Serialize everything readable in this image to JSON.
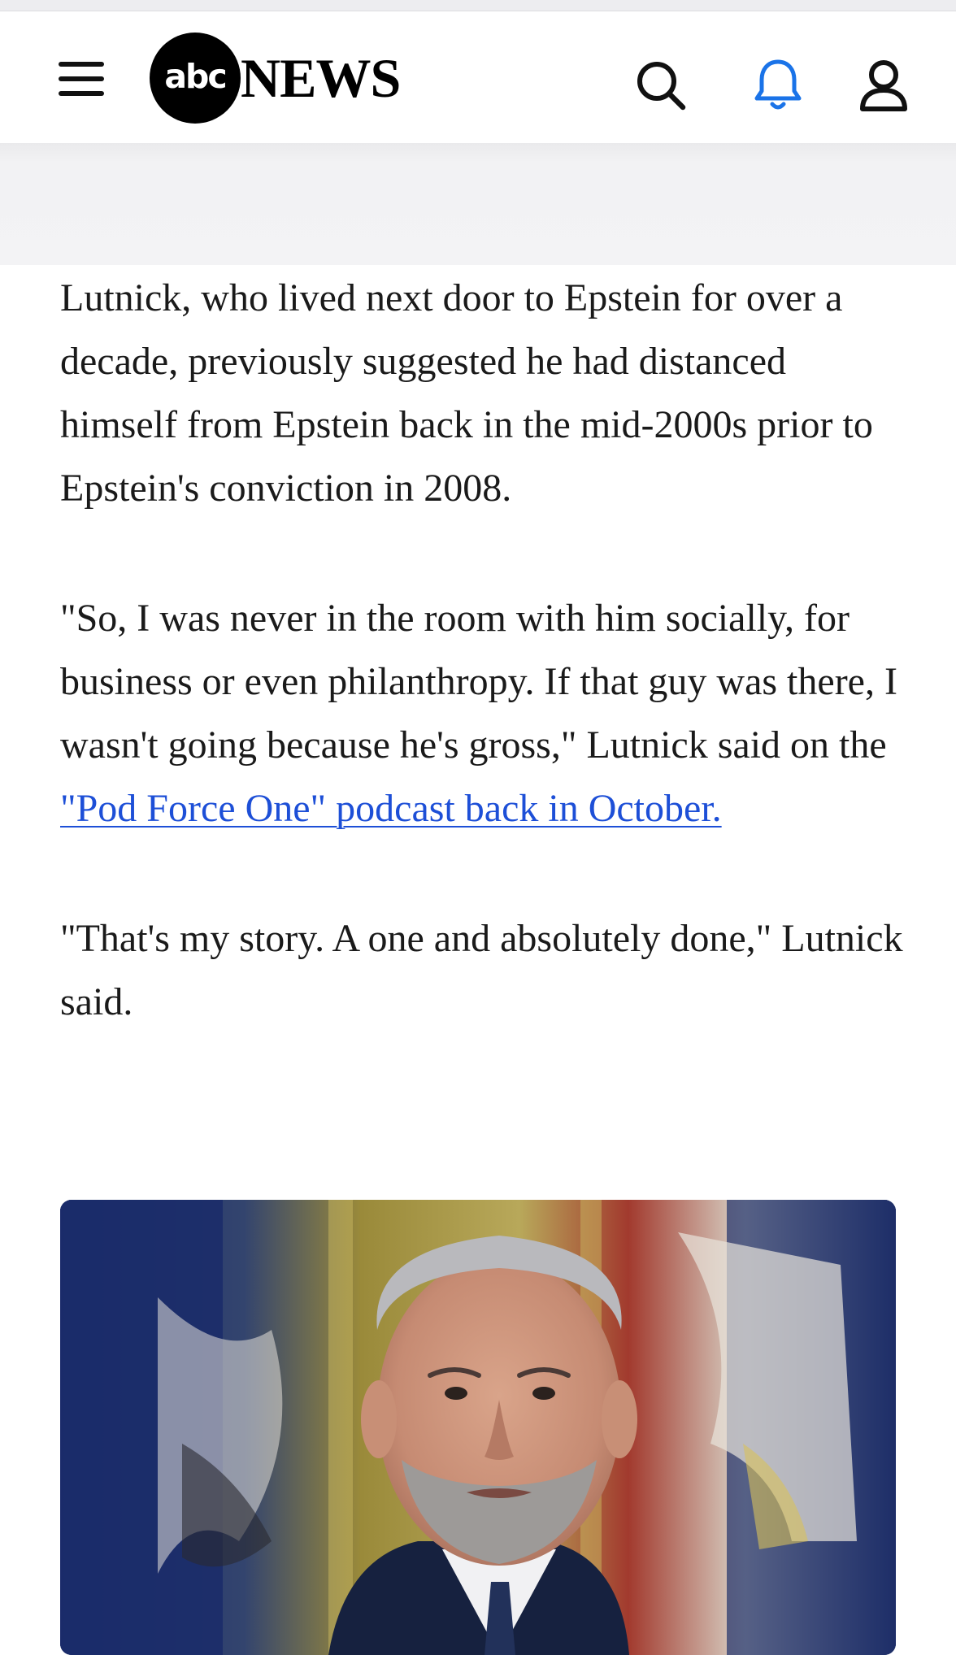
{
  "header": {
    "logo": {
      "mark": "abc",
      "wordmark": "NEWS"
    },
    "icons": {
      "menu": "menu-icon",
      "search": "search-icon",
      "notifications": "bell-icon",
      "account": "user-icon"
    },
    "colors": {
      "notification": "#1a73e8",
      "link": "#1d4fd7"
    }
  },
  "article": {
    "paragraphs": [
      "Lutnick, who lived next door to Epstein for over a decade, previously suggested he had distanced himself from Epstein back in the mid-2000s prior to Epstein's conviction in 2008.",
      {
        "text_before": "\"So, I was never in the room with him socially, for business or even philanthropy. If that guy was there, I wasn't going because he's gross,\" Lutnick said on the ",
        "link_text": "\"Pod Force One\" podcast back in October."
      },
      "\"That's my story. A one and absolutely done,\" Lutnick said."
    ],
    "photo": {
      "subject": "portrait-photo"
    }
  }
}
